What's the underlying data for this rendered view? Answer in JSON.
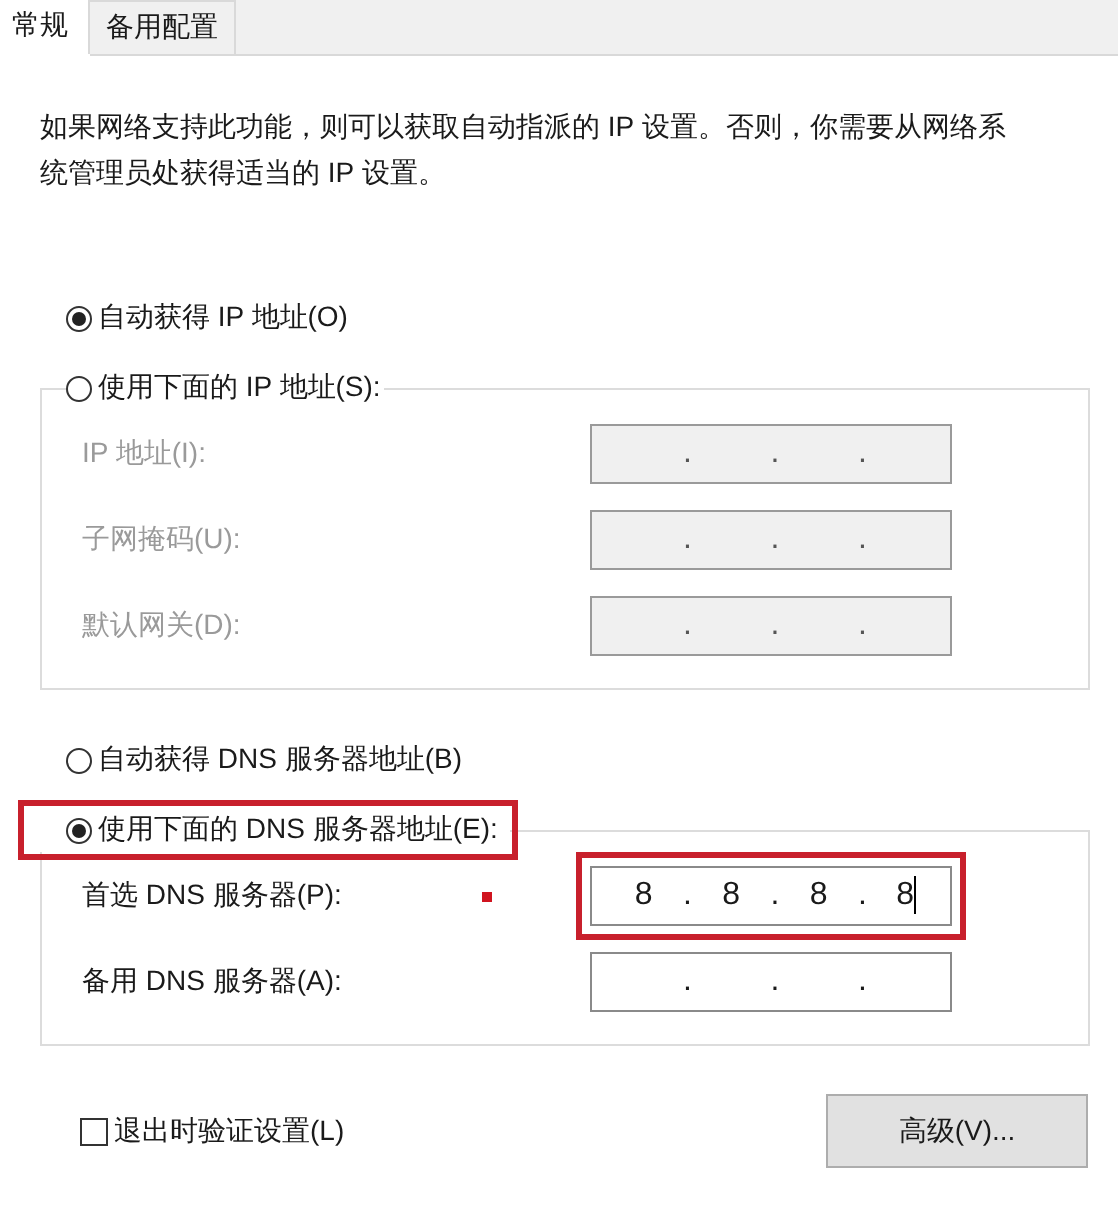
{
  "tabs": [
    {
      "label": "常规",
      "selected": true
    },
    {
      "label": "备用配置",
      "selected": false
    }
  ],
  "description": "如果网络支持此功能，则可以获取自动指派的 IP 设置。否则，你需要从网络系统管理员处获得适当的 IP 设置。",
  "ip_section": {
    "options": [
      {
        "label": "自动获得 IP 地址(O)",
        "selected": true,
        "highlighted": false
      },
      {
        "label": "使用下面的 IP 地址(S):",
        "selected": false,
        "highlighted": false
      }
    ],
    "fields": [
      {
        "label": "IP 地址(I):",
        "disabled": true,
        "dots": [
          ".",
          ".",
          "."
        ]
      },
      {
        "label": "子网掩码(U):",
        "disabled": true,
        "dots": [
          ".",
          ".",
          "."
        ]
      },
      {
        "label": "默认网关(D):",
        "disabled": true,
        "dots": [
          ".",
          ".",
          "."
        ]
      }
    ]
  },
  "dns_section": {
    "options": [
      {
        "label": "自动获得 DNS 服务器地址(B)",
        "selected": false,
        "highlighted": false
      },
      {
        "label": "使用下面的 DNS 服务器地址(E):",
        "selected": true,
        "highlighted": true
      }
    ],
    "fields": [
      {
        "label": "首选 DNS 服务器(P):",
        "disabled": false,
        "octets": [
          "8",
          "8",
          "8",
          "8"
        ],
        "dots": [
          ".",
          ".",
          "."
        ],
        "focused": true,
        "highlighted": true,
        "marker": true
      },
      {
        "label": "备用 DNS 服务器(A):",
        "disabled": false,
        "dots": [
          ".",
          ".",
          "."
        ]
      }
    ]
  },
  "checkbox": {
    "label": "退出时验证设置(L)",
    "checked": false
  },
  "buttons": [
    {
      "label": "高级(V)..."
    }
  ]
}
